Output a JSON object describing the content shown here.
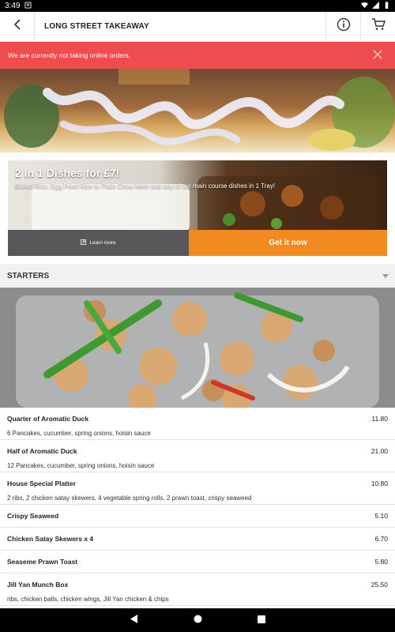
{
  "status_bar": {
    "time": "3:49"
  },
  "header": {
    "title": "LONG STREET TAKEAWAY"
  },
  "alert": {
    "message": "We are currently not taking online orders."
  },
  "promo": {
    "title": "2 In 1 Dishes for £7!",
    "description": "Boiled Rice, Egg Fried Rice or Plain Chow Mein and any of our main course dishes in 1 Tray!",
    "learn_more_label": "Learn more",
    "cta_label": "Get it now",
    "cta_color": "#f28b1f"
  },
  "section": {
    "title": "STARTERS"
  },
  "menu_items": [
    {
      "name": "Quarter of Aromatic Duck",
      "description": "6 Pancakes, cucumber, spring onions, hoisin sauce",
      "price": "11.80"
    },
    {
      "name": "Half of Aromatic Duck",
      "description": "12 Pancakes, cucumber, spring onions, hoisin sauce",
      "price": "21.00"
    },
    {
      "name": "House Special Platter",
      "description": "2 ribs, 2 chicken satay skewers, 4 vegetable spring rolls, 2 prawn toast, crispy seaweed",
      "price": "10.80"
    },
    {
      "name": "Crispy Seaweed",
      "description": "",
      "price": "5.10"
    },
    {
      "name": "Chicken Satay Skewers x 4",
      "description": "",
      "price": "6.70"
    },
    {
      "name": "Seaseme Prawn Toast",
      "description": "",
      "price": "5.80"
    },
    {
      "name": "Jill Yan Munch Box",
      "description": "ribs, chicken balls, chicken wings, Jill Yan chicken & chips",
      "price": "25.50"
    }
  ],
  "colors": {
    "alert": "#ee4c4f",
    "accent": "#f28b1f",
    "learn_more_bg": "#58585a"
  },
  "icons": {
    "back": "arrow-left-icon",
    "info": "info-icon",
    "cart": "cart-icon",
    "close": "close-icon",
    "chevron": "chevron-down-icon",
    "learn_more": "external-link-icon"
  }
}
